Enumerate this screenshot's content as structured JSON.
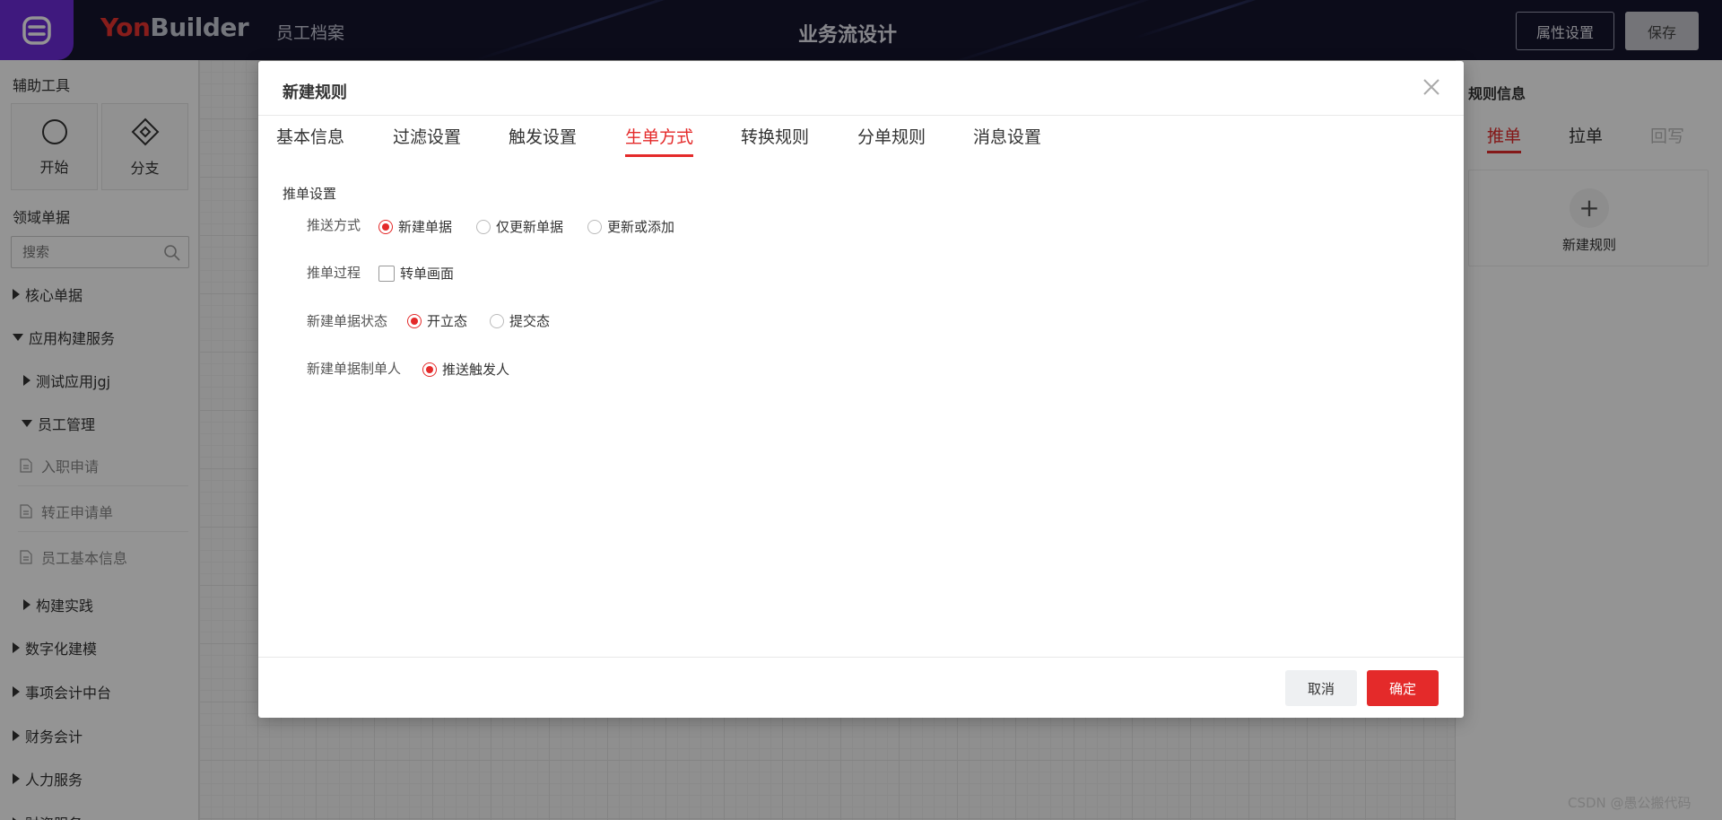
{
  "header": {
    "brand_yon": "Yon",
    "brand_builder": "Builder",
    "breadcrumb": "员工档案",
    "title": "业务流设计",
    "attr_button": "属性设置",
    "save_button": "保存"
  },
  "left": {
    "tools_title": "辅助工具",
    "tools": [
      {
        "label": "开始",
        "icon": "circle-icon"
      },
      {
        "label": "分支",
        "icon": "diamond-icon"
      }
    ],
    "domain_title": "领域单据",
    "search_placeholder": "搜索",
    "tree": [
      {
        "label": "核心单据",
        "expanded": false,
        "level": 0
      },
      {
        "label": "应用构建服务",
        "expanded": true,
        "level": 0
      },
      {
        "label": "测试应用jgj",
        "expanded": false,
        "level": 1
      },
      {
        "label": "员工管理",
        "expanded": true,
        "level": 1
      },
      {
        "label": "入职申请",
        "doc": true
      },
      {
        "label": "转正申请单",
        "doc": true
      },
      {
        "label": "员工基本信息",
        "doc": true
      },
      {
        "label": "构建实践",
        "expanded": false,
        "level": 1
      },
      {
        "label": "数字化建模",
        "expanded": false,
        "level": 0
      },
      {
        "label": "事项会计中台",
        "expanded": false,
        "level": 0
      },
      {
        "label": "财务会计",
        "expanded": false,
        "level": 0
      },
      {
        "label": "人力服务",
        "expanded": false,
        "level": 0
      },
      {
        "label": "财资服务",
        "expanded": false,
        "level": 0
      }
    ]
  },
  "right": {
    "title": "规则信息",
    "tabs": [
      "推单",
      "拉单",
      "回写"
    ],
    "active_tab": "推单",
    "new_rule": "新建规则",
    "plus": "+"
  },
  "modal": {
    "title": "新建规则",
    "tabs": [
      "基本信息",
      "过滤设置",
      "触发设置",
      "生单方式",
      "转换规则",
      "分单规则",
      "消息设置"
    ],
    "active_tab": "生单方式",
    "section": "推单设置",
    "fields": {
      "push_mode": {
        "label": "推送方式",
        "options": [
          "新建单据",
          "仅更新单据",
          "更新或添加"
        ],
        "selected": "新建单据"
      },
      "push_process": {
        "label": "推单过程",
        "checkbox": "转单画面",
        "checked": false
      },
      "new_status": {
        "label": "新建单据状态",
        "options": [
          "开立态",
          "提交态"
        ],
        "selected": "开立态"
      },
      "maker": {
        "label": "新建单据制单人",
        "options": [
          "推送触发人"
        ],
        "selected": "推送触发人"
      }
    },
    "cancel": "取消",
    "ok": "确定"
  },
  "watermark": "CSDN @愚公搬代码",
  "colors": {
    "accent": "#e42a2a",
    "topbar": "#15152e",
    "logo": "#6d2bd9"
  }
}
